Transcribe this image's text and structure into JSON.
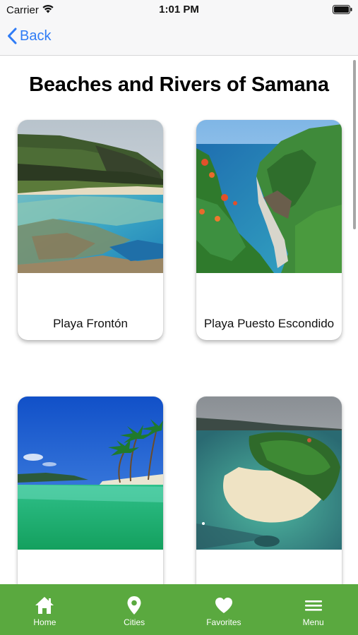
{
  "status_bar": {
    "carrier": "Carrier",
    "time": "1:01 PM",
    "wifi_icon": "wifi-icon",
    "battery_icon": "battery-icon"
  },
  "nav": {
    "back_label": "Back",
    "back_icon": "chevron-left-icon",
    "accent_color": "#2f7cf6"
  },
  "page": {
    "title": "Beaches and Rivers of Samana"
  },
  "cards": [
    {
      "label": "Playa Frontón"
    },
    {
      "label": "Playa Puesto Escondido"
    },
    {
      "label": ""
    },
    {
      "label": ""
    }
  ],
  "tab_bar": {
    "background_color": "#5aa93f",
    "items": [
      {
        "label": "Home",
        "icon": "home-icon"
      },
      {
        "label": "Cities",
        "icon": "location-pin-icon"
      },
      {
        "label": "Favorites",
        "icon": "heart-icon"
      },
      {
        "label": "Menu",
        "icon": "hamburger-menu-icon"
      }
    ]
  }
}
